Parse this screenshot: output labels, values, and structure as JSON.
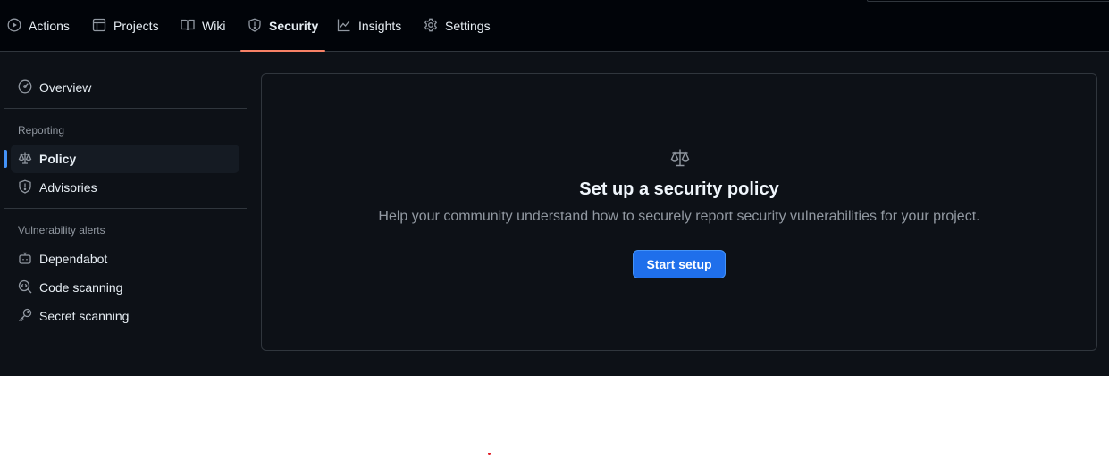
{
  "tabs": [
    {
      "label": "Actions",
      "icon": "play-icon"
    },
    {
      "label": "Projects",
      "icon": "table-icon"
    },
    {
      "label": "Wiki",
      "icon": "book-icon"
    },
    {
      "label": "Security",
      "icon": "shield-icon",
      "active": true
    },
    {
      "label": "Insights",
      "icon": "graph-icon"
    },
    {
      "label": "Settings",
      "icon": "gear-icon"
    }
  ],
  "sidebar": {
    "overview": {
      "label": "Overview",
      "icon": "meter-icon"
    },
    "reporting_heading": "Reporting",
    "reporting": [
      {
        "label": "Policy",
        "icon": "law-icon",
        "active": true
      },
      {
        "label": "Advisories",
        "icon": "shield-icon"
      }
    ],
    "vuln_heading": "Vulnerability alerts",
    "vuln": [
      {
        "label": "Dependabot",
        "icon": "dependabot-icon"
      },
      {
        "label": "Code scanning",
        "icon": "codescan-icon"
      },
      {
        "label": "Secret scanning",
        "icon": "key-icon"
      }
    ]
  },
  "main": {
    "icon": "law-icon",
    "title": "Set up a security policy",
    "description": "Help your community understand how to securely report security vulnerabilities for your project.",
    "button_label": "Start setup"
  },
  "colors": {
    "nav_bg": "#010409",
    "page_bg": "#0d1117",
    "active_tab_underline": "#f78166",
    "active_item_marker": "#4493f8",
    "primary_button": "#1f6feb"
  }
}
